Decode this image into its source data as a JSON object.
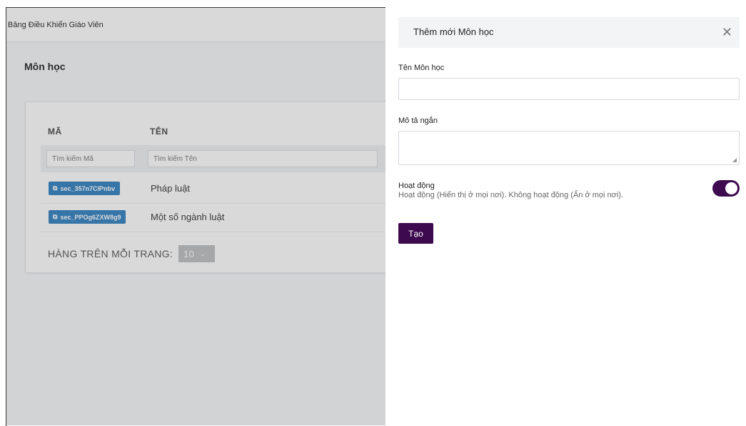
{
  "topbar": {
    "title": "Bảng Điều Khiển Giáo Viên"
  },
  "page": {
    "title": "Môn học"
  },
  "table": {
    "columns": [
      "MÃ",
      "TÊN"
    ],
    "filters": {
      "code_placeholder": "Tìm kiếm Mã",
      "name_placeholder": "Tìm kiếm Tên"
    },
    "rows": [
      {
        "code": "sec_357n7ClPnbv",
        "name": "Pháp luật"
      },
      {
        "code": "sec_PPOg6ZXW8g9",
        "name": "Một số ngành luật"
      }
    ],
    "pagination": {
      "label": "HÀNG TRÊN MỖI TRANG:",
      "per_page": "10"
    }
  },
  "drawer": {
    "title": "Thêm mới Môn học",
    "name_label": "Tên Môn học",
    "name_value": "",
    "desc_label": "Mô tả ngắn",
    "desc_value": "",
    "active_label": "Hoạt động",
    "active_desc": "Hoạt động (Hiển thị ở mọi nơi). Không hoạt động (Ẩn ở mọi nơi).",
    "active": true,
    "submit_label": "Tạo"
  },
  "colors": {
    "accent": "#3d0a4f",
    "badge": "#2f7fc1"
  }
}
